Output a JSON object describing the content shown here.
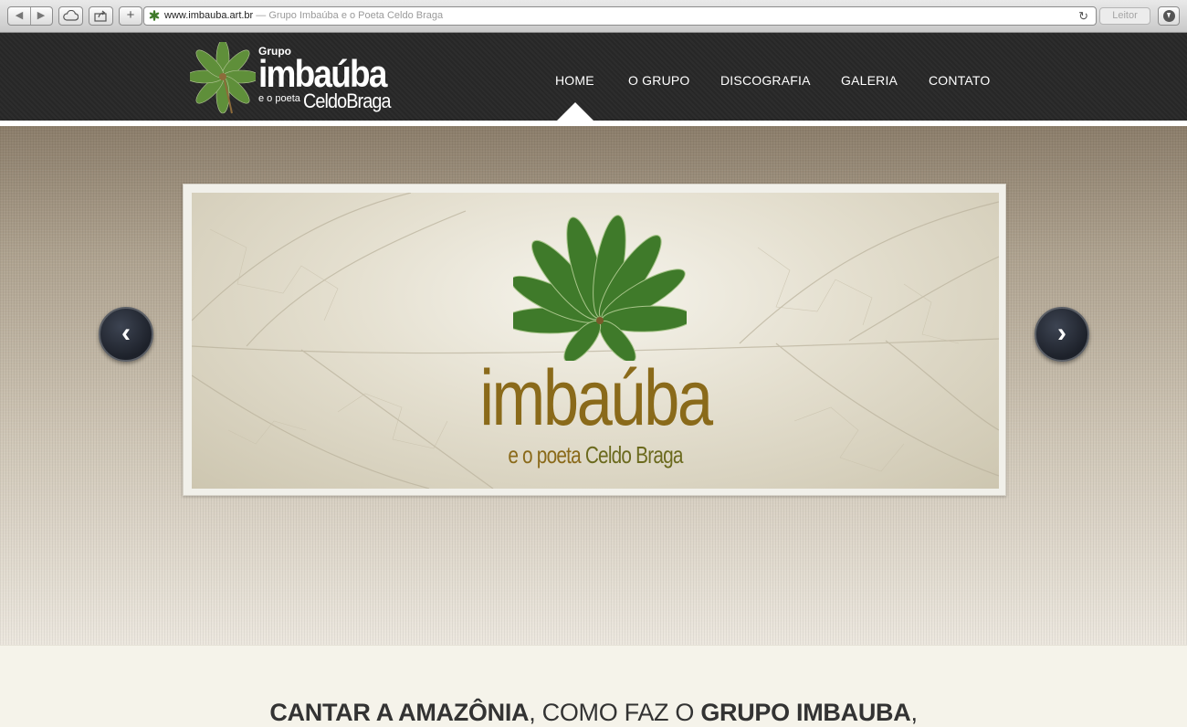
{
  "browser": {
    "url": "www.imbauba.art.br",
    "separator": " — ",
    "page_title": "Grupo Imbaúba e o Poeta Celdo Braga",
    "reader_label": "Leitor",
    "back_glyph": "◀",
    "forward_glyph": "▶",
    "plus_glyph": "+",
    "reload_glyph": "↻"
  },
  "logo": {
    "grupo": "Grupo",
    "imbauba": "imbaúba",
    "e_o_poeta": "e o poeta",
    "celdo_braga": "CeldoBraga"
  },
  "nav": {
    "items": [
      {
        "label": "HOME",
        "active": true
      },
      {
        "label": "O GRUPO"
      },
      {
        "label": "DISCOGRAFIA"
      },
      {
        "label": "GALERIA"
      },
      {
        "label": "CONTATO"
      }
    ]
  },
  "slider": {
    "title": "imbaúba",
    "sub_prefix": "e o poeta ",
    "sub_name": "Celdo Braga",
    "prev_glyph": "‹",
    "next_glyph": "›"
  },
  "intro": {
    "part1": "CANTAR A AMAZÔNIA",
    "part2": ", COMO FAZ O ",
    "part3": "GRUPO IMBAUBA",
    "part4": ","
  },
  "colors": {
    "header_bg": "#2b2b2b",
    "brand_brown": "#8a6a1a",
    "leaf_green": "#3f7a2a"
  }
}
